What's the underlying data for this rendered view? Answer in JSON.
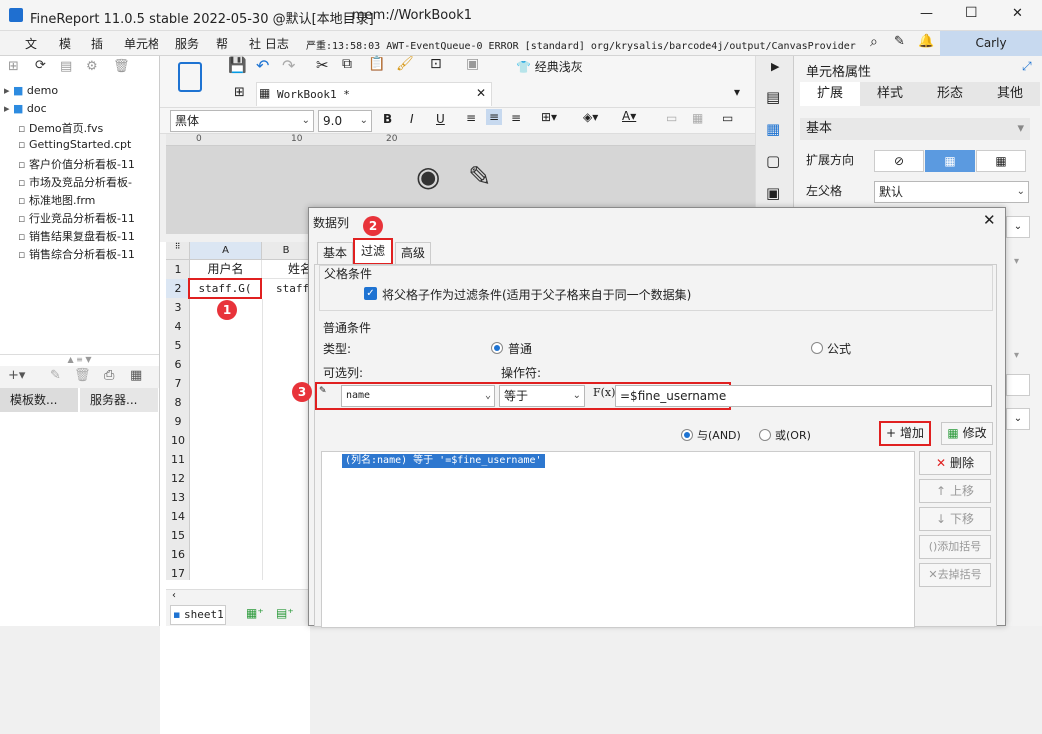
{
  "app": {
    "title": "FineReport 11.0.5 stable 2022-05-30 @默认[本地目录]",
    "path": "mem://WorkBook1",
    "minimize": "—",
    "maximize": "☐",
    "close": "✕"
  },
  "menu": {
    "items": [
      "文",
      "模",
      "插",
      "单元格",
      "服务",
      "帮",
      "社 日志"
    ],
    "log": "严重:13:58:03 AWT-EventQueue-0 ERROR [standard] org/krysalis/barcode4j/output/CanvasProvider",
    "user": "Carly"
  },
  "tree": {
    "items": [
      {
        "label": "demo",
        "type": "folder"
      },
      {
        "label": "doc",
        "type": "folder"
      },
      {
        "label": "Demo首页.fvs",
        "type": "file"
      },
      {
        "label": "GettingStarted.cpt",
        "type": "file"
      },
      {
        "label": "客户价值分析看板-11",
        "type": "file"
      },
      {
        "label": "市场及竞品分析看板-",
        "type": "file"
      },
      {
        "label": "标准地图.frm",
        "type": "file"
      },
      {
        "label": "行业竞品分析看板-11",
        "type": "file"
      },
      {
        "label": "销售结果复盘看板-11",
        "type": "file"
      },
      {
        "label": "销售综合分析看板-11",
        "type": "file"
      }
    ],
    "tab1": "模板数...",
    "tab2": "服务器..."
  },
  "toolbar": {
    "classic_gray": "经典浅灰",
    "workbook_tab": "WorkBook1 *",
    "font": "黑体",
    "font_size": "9.0"
  },
  "sheet": {
    "cols": [
      "A",
      "B"
    ],
    "rows": [
      "1",
      "2",
      "3",
      "4",
      "5",
      "6",
      "7",
      "8",
      "9",
      "10",
      "11",
      "12",
      "13",
      "14",
      "15",
      "16",
      "17"
    ],
    "a1": "用户名",
    "b1": "姓名",
    "a2": "staff.G(",
    "b2": "staff.",
    "sheet_tab": "sheet1"
  },
  "right_panel": {
    "title": "单元格属性",
    "tabs": [
      "扩展",
      "样式",
      "形态",
      "其他"
    ],
    "section": "基本",
    "expand_dir_label": "扩展方向",
    "left_parent_label": "左父格",
    "left_parent_value": "默认"
  },
  "dialog": {
    "title": "数据列",
    "tabs": [
      "基本",
      "过滤",
      "高级"
    ],
    "parent_section": "父格条件",
    "parent_checkbox": "将父格子作为过滤条件(适用于父子格来自于同一个数据集)",
    "normal_section": "普通条件",
    "type_label": "类型:",
    "type_normal": "普通",
    "type_formula": "公式",
    "col_label": "可选列:",
    "op_label": "操作符:",
    "col_value": "name",
    "op_value": "等于",
    "fx": "F(x)",
    "value": "=$fine_username",
    "and_label": "与(AND)",
    "or_label": "或(OR)",
    "add_btn": "增加",
    "modify_btn": "修改",
    "delete_btn": "删除",
    "up_btn": "上移",
    "down_btn": "下移",
    "add_paren_btn": "添加括号",
    "remove_paren_btn": "去掉括号",
    "condition": "(列名:name) 等于 '=$fine_username'"
  },
  "badges": [
    "1",
    "2",
    "3"
  ]
}
